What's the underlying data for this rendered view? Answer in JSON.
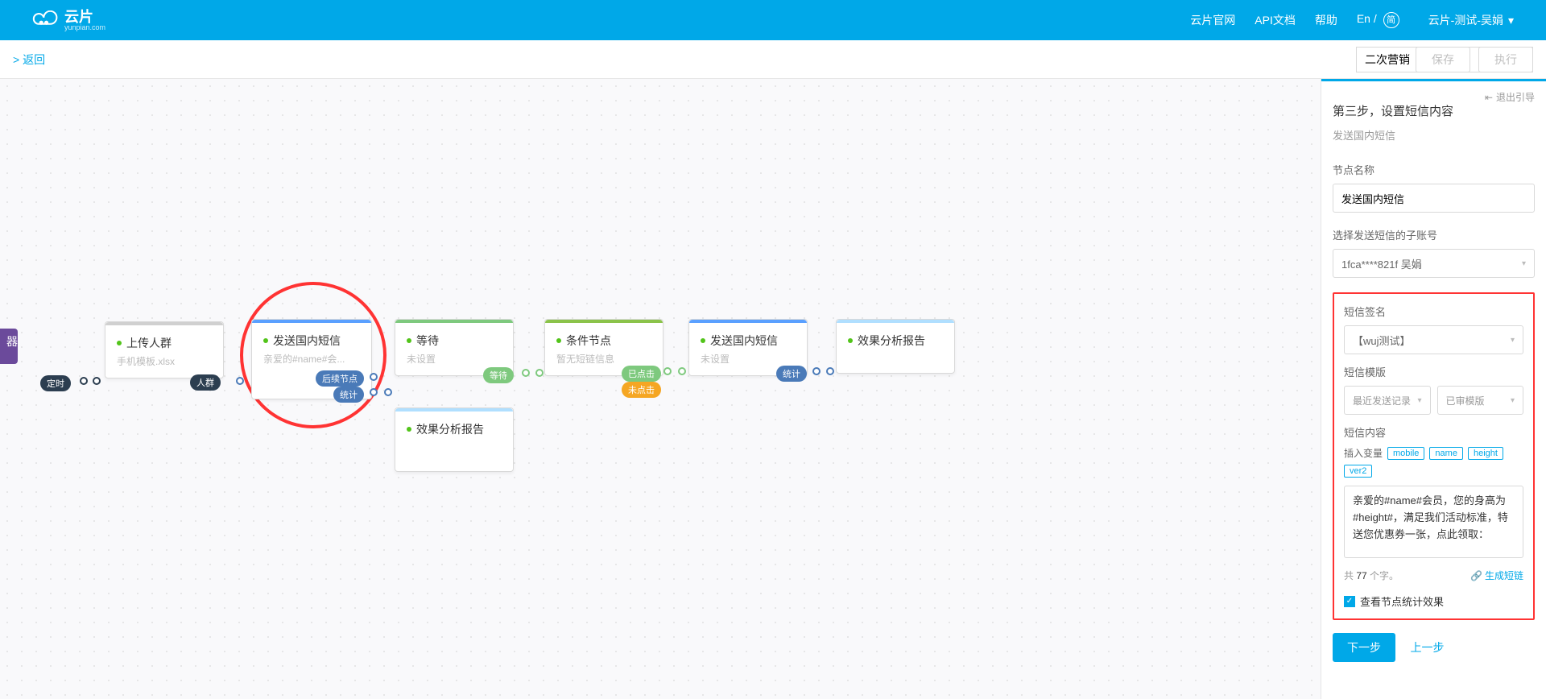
{
  "header": {
    "logo_main": "云片",
    "logo_sub": "yunpian.com",
    "nav": {
      "home": "云片官网",
      "api": "API文档",
      "help": "帮助",
      "lang": "En /",
      "lang_badge": "简",
      "user": "云片-测试-吴娟"
    }
  },
  "toolbar": {
    "back": ">  返回",
    "title_value": "二次营销",
    "save": "保存",
    "run": "执行"
  },
  "panel": {
    "exit_guide": "退出引导",
    "title": "第三步，设置短信内容",
    "subtitle": "发送国内短信",
    "node_name_label": "节点名称",
    "node_name_value": "发送国内短信",
    "sub_account_label": "选择发送短信的子账号",
    "sub_account_value": "1fca****821f 吴娟",
    "sign_label": "短信签名",
    "sign_value": "【wuj测试】",
    "template_label": "短信模版",
    "template_recent": "最近发送记录",
    "template_approved": "已审模版",
    "content_label": "短信内容",
    "var_label": "插入变量",
    "vars": [
      "mobile",
      "name",
      "height",
      "ver2"
    ],
    "sms_text": "亲爱的#name#会员，您的身高为#height#，满足我们活动标准，特送您优惠券一张，点此领取：",
    "char_prefix": "共 ",
    "char_count": "77",
    "char_suffix": " 个字。",
    "gen_link": "生成短链",
    "view_stats": "查看节点统计效果",
    "next": "下一步",
    "prev": "上一步"
  },
  "nodes": {
    "entry": {
      "title": "器",
      "tag": "定时"
    },
    "upload": {
      "title": "上传人群",
      "sub": "手机模板.xlsx",
      "tag": "人群"
    },
    "send_sms": {
      "title": "发送国内短信",
      "sub": "亲爱的#name#会...",
      "tag1": "后续节点",
      "tag2": "统计"
    },
    "wait": {
      "title": "等待",
      "sub": "未设置",
      "tag": "等待"
    },
    "report1": {
      "title": "效果分析报告",
      "sub": ""
    },
    "condition": {
      "title": "条件节点",
      "sub": "暂无短链信息",
      "tag1": "已点击",
      "tag2": "未点击"
    },
    "send_sms2": {
      "title": "发送国内短信",
      "sub": "未设置",
      "tag": "统计"
    },
    "report2": {
      "title": "效果分析报告",
      "sub": ""
    }
  }
}
